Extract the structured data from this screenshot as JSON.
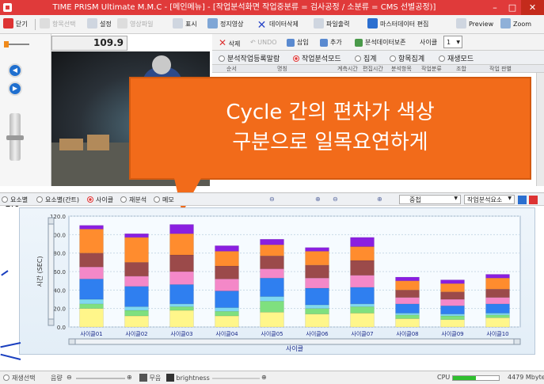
{
  "window": {
    "title": "TIME PRISM Ultimate M.M.C - [메인메뉴] - [작업분석화면 작업중분류 = 검사공정 / 소분류 = CMS 선별공정)]",
    "minimize": "–",
    "maximize": "□",
    "close": "✕"
  },
  "toolbar": {
    "close_label": "닫기",
    "item_select_label": "항목선택",
    "settings_label": "설정",
    "video_open_label": "영상파일",
    "display_label": "표시",
    "still_image_label": "정지영상",
    "data_delete_label": "데이터삭제",
    "file_output_label": "파일출력",
    "master_edit_label": "마스터데이터 편집",
    "preview_label": "Preview",
    "zoom_label": "Zoom"
  },
  "player": {
    "time_value": "109.9",
    "speed_value": "1.0",
    "prev_symbol": "◀",
    "next_symbol": "▶"
  },
  "right_toolbar": {
    "delete_label": "삭제",
    "undo_label": "UNDO",
    "insert_label": "삽입",
    "add_label": "추가",
    "save_analysis_label": "분석데이터보존",
    "cycle_label": "사이클",
    "cycle_value": "1"
  },
  "right_tabs": [
    {
      "label": "분석작업등록말람",
      "selected": false
    },
    {
      "label": "작업분석모드",
      "selected": true
    },
    {
      "label": "집계",
      "selected": false
    },
    {
      "label": "항목집계",
      "selected": false
    },
    {
      "label": "재생모드",
      "selected": false
    }
  ],
  "grid_headers": [
    "순서",
    "명칭",
    "계측시간",
    "편집시간",
    "분석항목",
    "작업분류",
    "조합",
    "작업 판별"
  ],
  "callout": {
    "line1": "Cycle 간의 편차가 색상",
    "line2": "구분으로 일목요연하게"
  },
  "lower_tabs": [
    {
      "label": "요소별",
      "selected": false
    },
    {
      "label": "요소별(간트)",
      "selected": false
    },
    {
      "label": "사이클",
      "selected": true
    },
    {
      "label": "재분석",
      "selected": false
    },
    {
      "label": "메모",
      "selected": false
    }
  ],
  "chart_controls": {
    "stack_label": "중첩",
    "element_select_label": "작업분석요소"
  },
  "chart_data": {
    "type": "bar",
    "stacked": true,
    "categories": [
      "사이클01",
      "사이클02",
      "사이클03",
      "사이클04",
      "사이클05",
      "사이클06",
      "사이클07",
      "사이클08",
      "사이클09",
      "사이클10"
    ],
    "xlabel": "사이클",
    "ylabel": "시간 (SEC)",
    "ylim": [
      0,
      120
    ],
    "yticks": [
      "0.0",
      "20.0",
      "40.0",
      "60.0",
      "80.0",
      "100.0",
      "120.0"
    ],
    "grid": true,
    "series": [
      {
        "color": "#fff68a",
        "values": [
          20,
          12,
          18,
          12,
          16,
          14,
          15,
          9,
          8,
          10
        ]
      },
      {
        "color": "#7fe07f",
        "values": [
          5,
          6,
          4,
          5,
          12,
          6,
          7,
          4,
          4,
          3
        ]
      },
      {
        "color": "#7fd8f0",
        "values": [
          5,
          4,
          3,
          4,
          5,
          4,
          3,
          2,
          2,
          2
        ]
      },
      {
        "color": "#2f7ff0",
        "values": [
          22,
          22,
          21,
          18,
          20,
          18,
          18,
          10,
          9,
          10
        ]
      },
      {
        "color": "#f488c8",
        "values": [
          13,
          11,
          14,
          13,
          10,
          11,
          13,
          7,
          7,
          7
        ]
      },
      {
        "color": "#9b4a4a",
        "values": [
          15,
          15,
          18,
          14,
          14,
          14,
          16,
          8,
          8,
          9
        ]
      },
      {
        "color": "#ff8c2e",
        "values": [
          26,
          27,
          23,
          16,
          12,
          15,
          15,
          10,
          9,
          12
        ]
      },
      {
        "color": "#8a1fe0",
        "values": [
          4,
          4,
          10,
          6,
          6,
          4,
          10,
          4,
          4,
          4
        ]
      }
    ]
  },
  "status": {
    "playback_label": "재생선택",
    "volume_label": "음량",
    "mute_label": "무음",
    "brightness_label": "brightness",
    "cpu_label": "CPU",
    "cpu_level": 0.5,
    "memory_label": "4479 Mbyte"
  },
  "colors": {
    "title_bar": "#e03a3a",
    "callout_bg": "#f26b1a",
    "arrow": "#1a3fbf"
  }
}
